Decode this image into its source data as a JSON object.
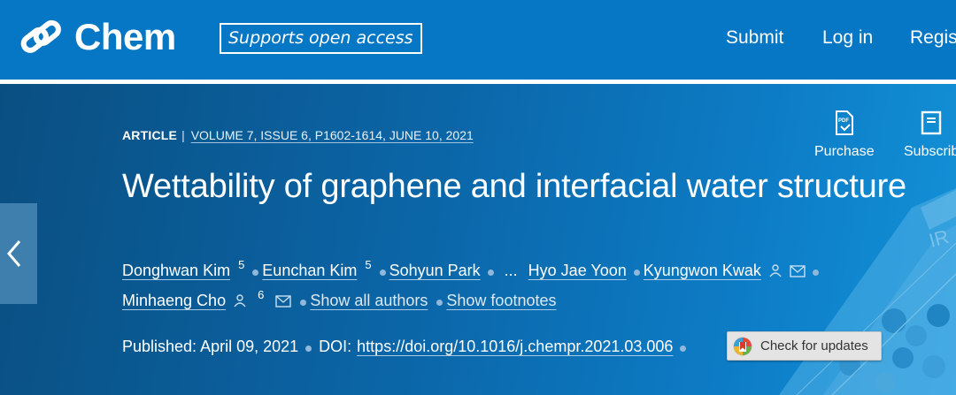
{
  "header": {
    "brand": "Chem",
    "tagline": "Supports open access",
    "nav": {
      "submit": "Submit",
      "login": "Log in",
      "register": "Regis"
    }
  },
  "article": {
    "kind": "ARTICLE",
    "separator": "|",
    "volume_info": "VOLUME 7, ISSUE 6, P1602-1614, JUNE 10, 2021",
    "title": "Wettability of graphene and interfacial water structure",
    "authors": [
      {
        "name": "Donghwan Kim",
        "footnote": "5"
      },
      {
        "name": "Eunchan Kim",
        "footnote": "5"
      },
      {
        "name": "Sohyun Park",
        "footnote": ""
      },
      {
        "name": "Hyo Jae Yoon",
        "footnote": ""
      },
      {
        "name": "Kyungwon Kwak",
        "footnote": ""
      },
      {
        "name": "Minhaeng Cho",
        "footnote": "6"
      }
    ],
    "ellipsis": "...",
    "show_all_authors": "Show all authors",
    "show_footnotes": "Show footnotes",
    "published_label": "Published: April 09, 2021",
    "doi_label": "DOI:",
    "doi": "https://doi.org/10.1016/j.chempr.2021.03.006",
    "check_updates": "Check for updates"
  },
  "actions": {
    "purchase": "Purchase",
    "subscribe": "Subscrib"
  },
  "icons": {
    "logo": "chem-link-logo",
    "pdf": "pdf-icon",
    "subscribe": "journal-icon",
    "person": "person-icon",
    "mail": "mail-icon",
    "prev": "chevron-left-icon",
    "check_updates": "crossmark-icon"
  },
  "colors": {
    "topbar": "#0677c5",
    "hero": "#0b66a8",
    "text": "#ffffff"
  }
}
